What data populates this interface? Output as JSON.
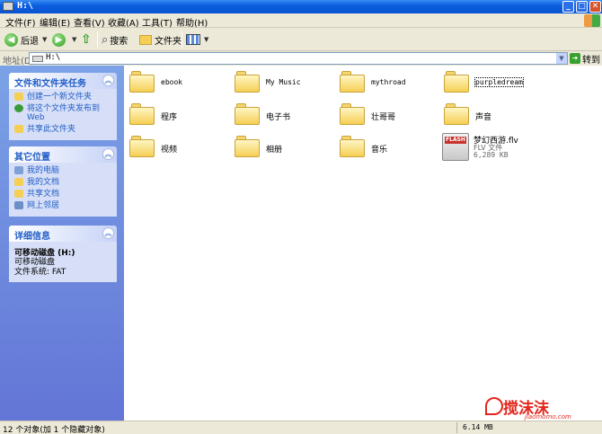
{
  "window": {
    "title": "H:\\"
  },
  "menu": [
    "文件(F)",
    "编辑(E)",
    "查看(V)",
    "收藏(A)",
    "工具(T)",
    "帮助(H)"
  ],
  "toolbar": {
    "back": "后退",
    "search": "搜索",
    "folders": "文件夹"
  },
  "address": {
    "label": "地址(D)",
    "path": "H:\\",
    "go": "转到"
  },
  "tasks": {
    "title": "文件和文件夹任务",
    "items": [
      "创建一个新文件夹",
      "将这个文件夹发布到 Web",
      "共享此文件夹"
    ]
  },
  "places": {
    "title": "其它位置",
    "items": [
      "我的电脑",
      "我的文档",
      "共享文档",
      "网上邻居"
    ]
  },
  "details": {
    "title": "详细信息",
    "name": "可移动磁盘 (H:)",
    "type": "可移动磁盘",
    "fs": "文件系统: FAT"
  },
  "files": [
    {
      "name": "ebook"
    },
    {
      "name": "My Music"
    },
    {
      "name": "mythroad"
    },
    {
      "name": "purpledream"
    },
    {
      "name": "程序"
    },
    {
      "name": "电子书"
    },
    {
      "name": "壮哥哥"
    },
    {
      "name": "声音"
    },
    {
      "name": "视频"
    },
    {
      "name": "相册"
    },
    {
      "name": "音乐"
    }
  ],
  "flv": {
    "name": "梦幻西游.flv",
    "type": "FLV 文件",
    "size": "6,289 KB",
    "badge": "FLASH"
  },
  "status": {
    "left": "12 个对象(加 1 个隐藏对象)",
    "size": "6.14 MB"
  },
  "watermark": {
    "text": "搅沫沫",
    "url": "jiaomomo.com"
  }
}
